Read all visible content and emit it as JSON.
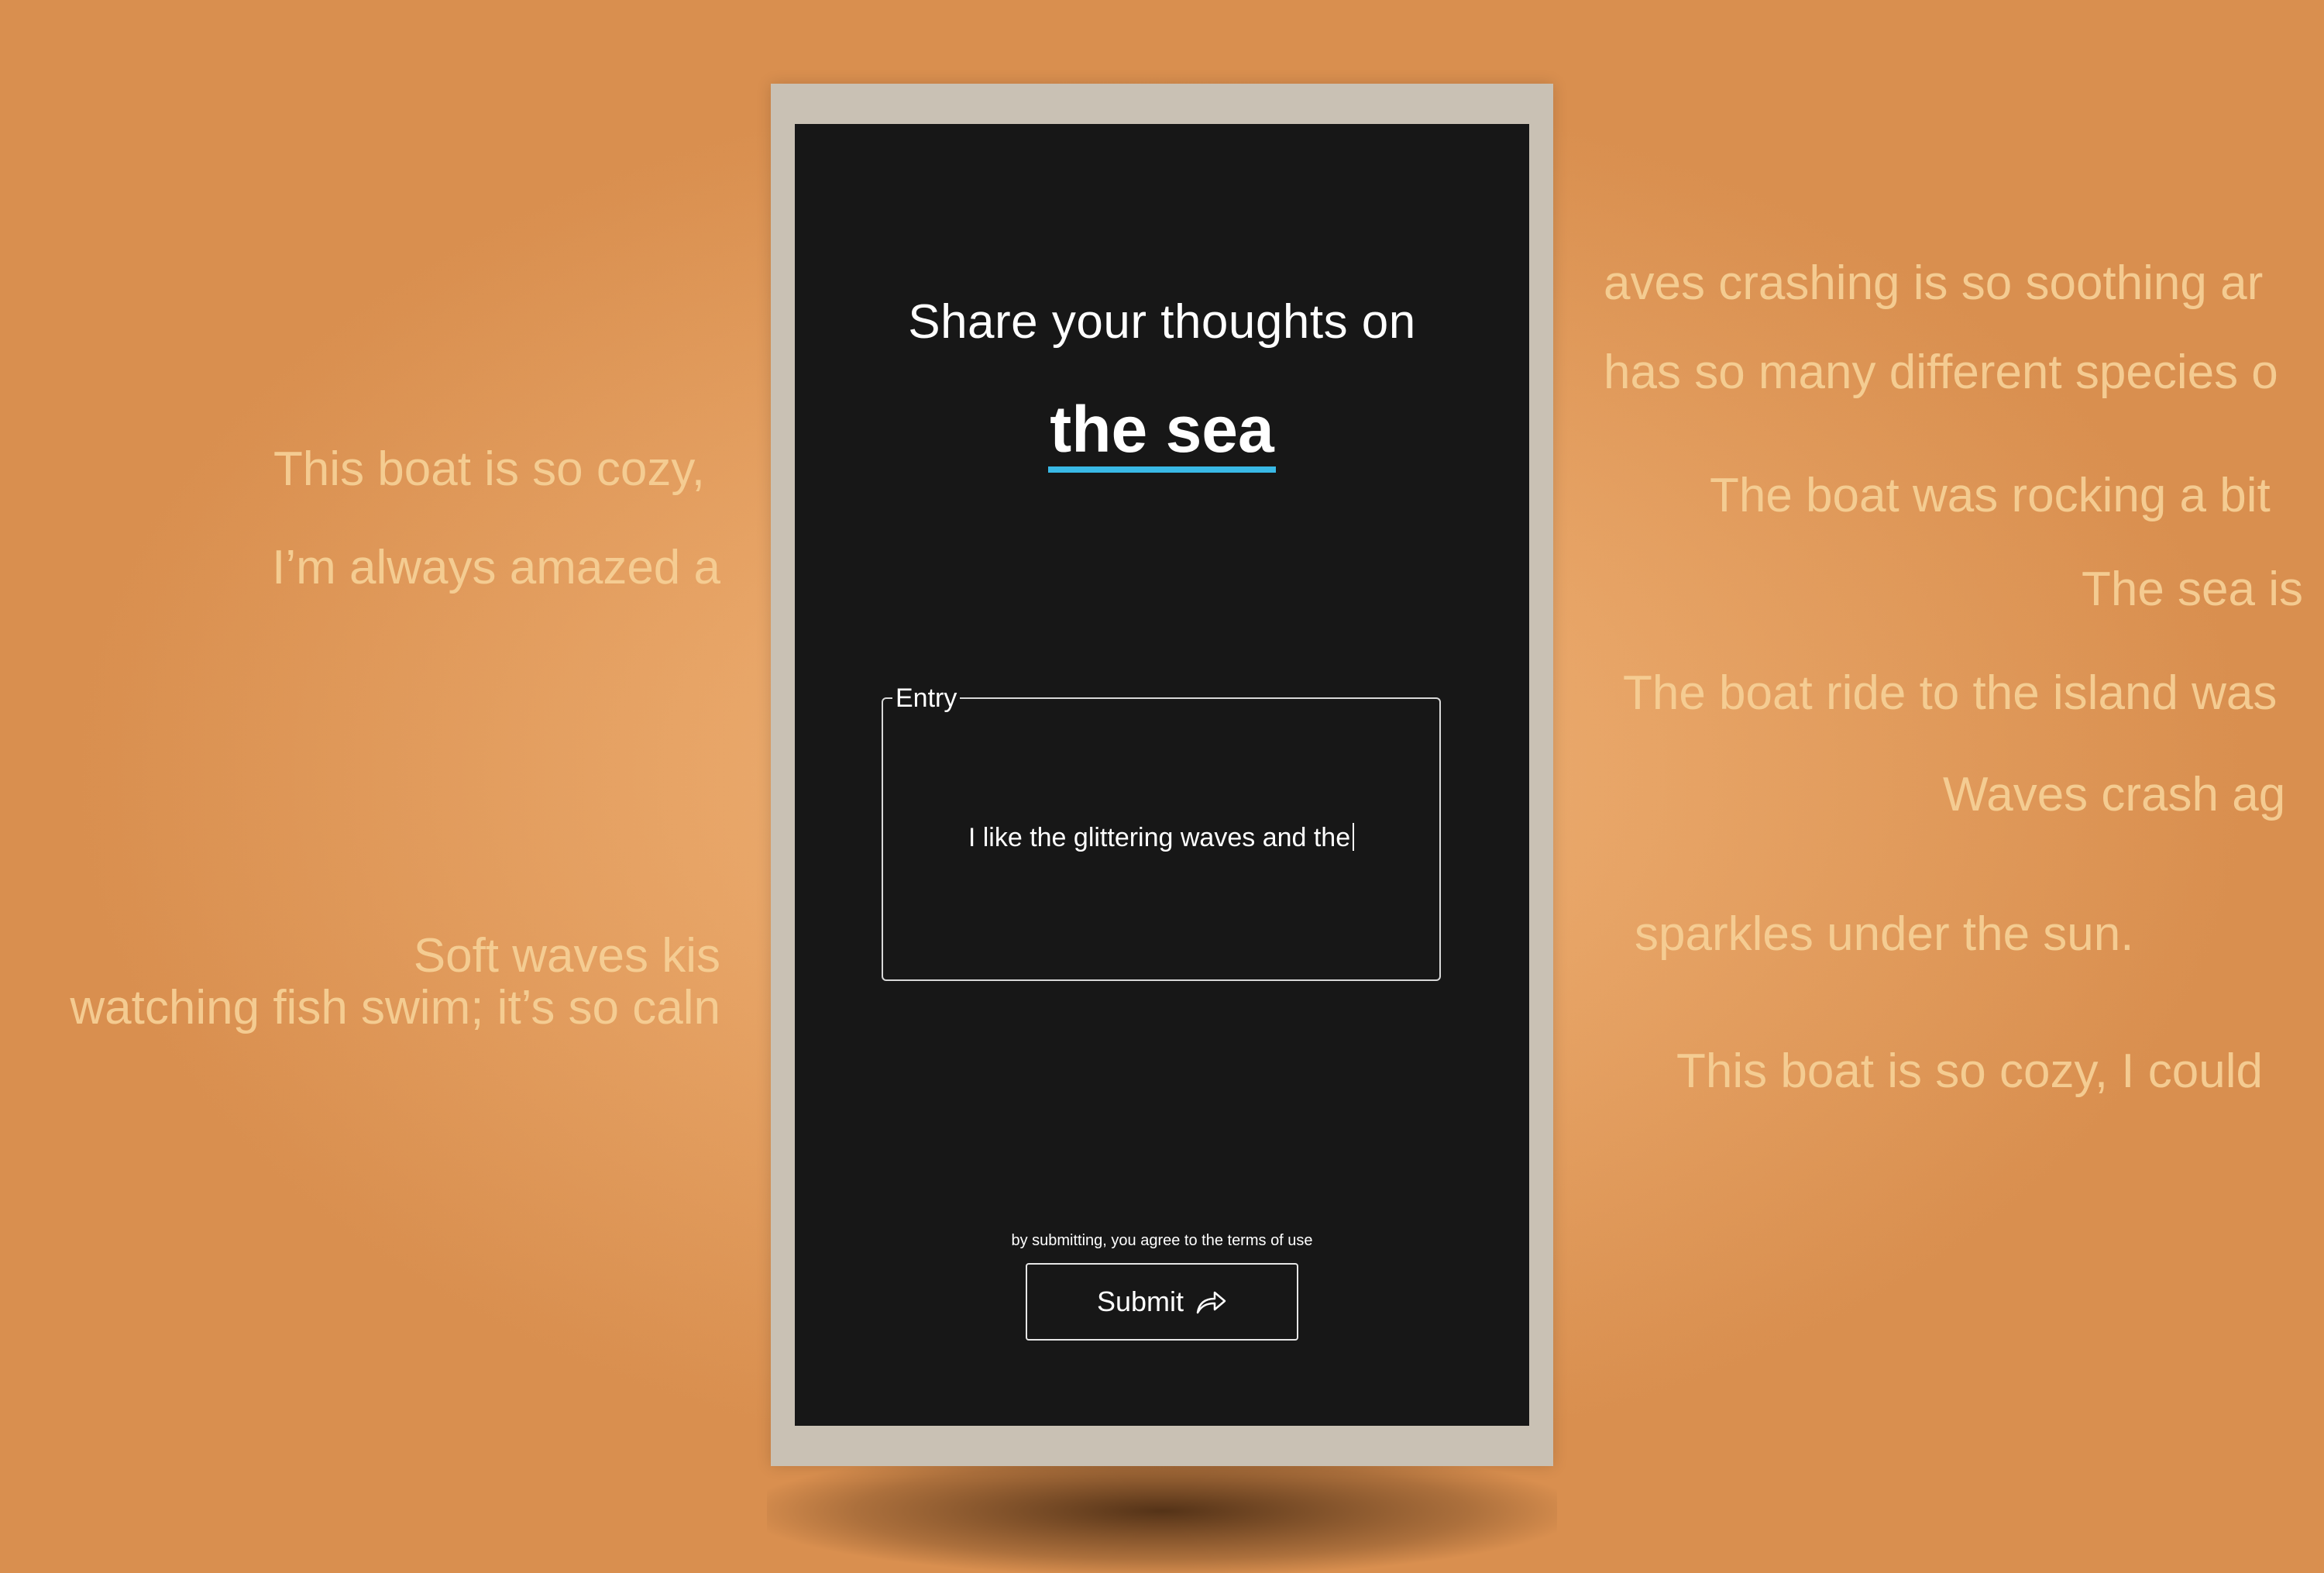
{
  "prompt": {
    "heading": "Share your thoughts on",
    "topic": "the sea",
    "accent_color": "#39b9e6"
  },
  "entry": {
    "label": "Entry",
    "value": "I like the glittering waves and the"
  },
  "footer": {
    "terms": "by submitting, you agree to the terms of use",
    "submit_label": "Submit",
    "submit_icon": "share-arrow-icon"
  },
  "background_text": {
    "left": [
      "This boat is so cozy,",
      "I’m always amazed a",
      "Soft waves kis",
      "watching fish swim; it’s so caln"
    ],
    "right": [
      "aves crashing is so soothing ar",
      "has so many different species o",
      "The boat was rocking a bit",
      "The sea is",
      "The boat ride to the island was",
      "Waves crash ag",
      "sparkles under the sun.",
      "This boat is so cozy, I could"
    ]
  }
}
